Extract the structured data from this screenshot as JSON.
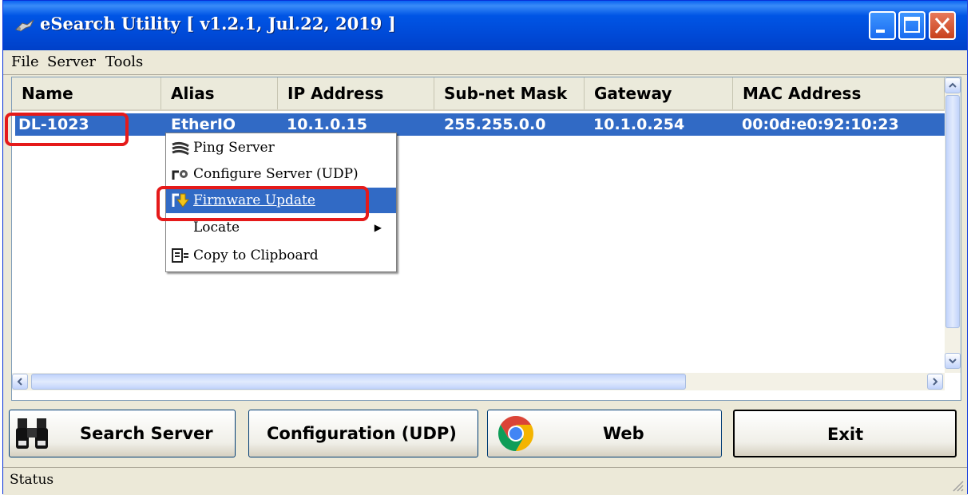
{
  "window": {
    "title": "eSearch Utility [ v1.2.1, Jul.22, 2019 ]"
  },
  "menubar": {
    "items": [
      "File",
      "Server",
      "Tools"
    ]
  },
  "table": {
    "columns": [
      "Name",
      "Alias",
      "IP Address",
      "Sub-net Mask",
      "Gateway",
      "MAC Address"
    ],
    "rows": [
      {
        "name": "DL-1023",
        "alias": "EtherIO",
        "ip": "10.1.0.15",
        "mask": "255.255.0.0",
        "gateway": "10.1.0.254",
        "mac": "00:0d:e0:92:10:23"
      }
    ]
  },
  "context_menu": {
    "items": [
      {
        "label": "Ping Server",
        "icon": "ping-icon"
      },
      {
        "label": "Configure Server (UDP)",
        "icon": "configure-icon"
      },
      {
        "label": "Firmware Update",
        "icon": "firmware-icon",
        "selected": true
      },
      {
        "label": "Locate",
        "submenu": true
      },
      {
        "label": "Copy to Clipboard",
        "icon": "clipboard-icon"
      }
    ]
  },
  "buttons": {
    "search": "Search Server",
    "configuration": "Configuration (UDP)",
    "web": "Web",
    "exit": "Exit"
  },
  "status": {
    "text": "Status"
  },
  "colors": {
    "titlebar": "#0055e5",
    "selection": "#316ac5",
    "highlight_box": "#e51a1a"
  }
}
